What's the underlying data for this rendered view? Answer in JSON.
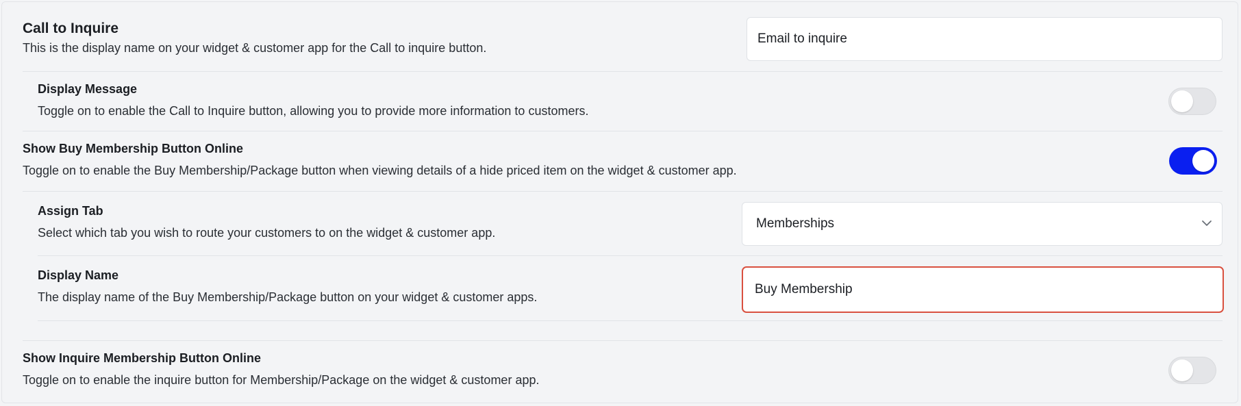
{
  "call_to_inquire": {
    "title": "Call to Inquire",
    "description": "This is the display name on your widget & customer app for the Call to inquire button.",
    "input_value": "Email to inquire"
  },
  "display_message": {
    "title": "Display Message",
    "description": "Toggle on to enable the Call to Inquire button, allowing you to provide more information to customers.",
    "toggle_on": false
  },
  "show_buy_membership": {
    "title": "Show Buy Membership Button Online",
    "description": "Toggle on to enable the Buy Membership/Package button when viewing details of a hide priced item on the widget & customer app.",
    "toggle_on": true
  },
  "assign_tab": {
    "title": "Assign Tab",
    "description": "Select which tab you wish to route your customers to on the widget & customer app.",
    "selected": "Memberships"
  },
  "display_name": {
    "title": "Display Name",
    "description": "The display name of the Buy Membership/Package button on your widget & customer apps.",
    "input_value": "Buy Membership"
  },
  "show_inquire_membership": {
    "title": "Show Inquire Membership Button Online",
    "description": "Toggle on to enable the inquire button for Membership/Package on the widget & customer app.",
    "toggle_on": false
  },
  "colors": {
    "toggle_on": "#0a1ff0",
    "toggle_off": "#e4e5e8",
    "focus_border": "#d9503f",
    "background": "#f3f4f6"
  },
  "icons": {
    "select_chevron": "chevron-down-icon"
  }
}
